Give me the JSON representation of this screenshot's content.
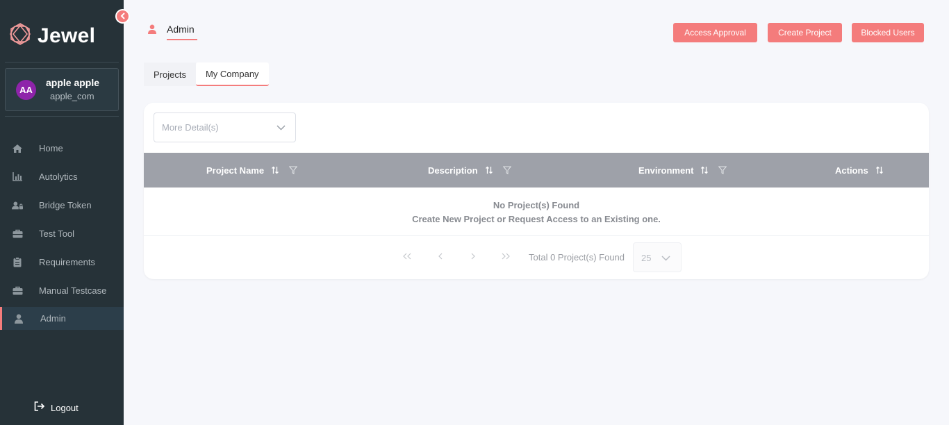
{
  "app": {
    "name": "Jewel"
  },
  "user": {
    "initials": "AA",
    "name": "apple apple",
    "handle": "apple_com"
  },
  "sidebar": {
    "items": [
      {
        "label": "Home",
        "icon": "home-icon"
      },
      {
        "label": "Autolytics",
        "icon": "bar-chart-icon"
      },
      {
        "label": "Bridge Token",
        "icon": "user-lock-icon"
      },
      {
        "label": "Test Tool",
        "icon": "toolbox-icon"
      },
      {
        "label": "Requirements",
        "icon": "clipboard-icon"
      },
      {
        "label": "Manual Testcase",
        "icon": "toolbox-icon"
      },
      {
        "label": "Admin",
        "icon": "user-icon",
        "active": true
      }
    ],
    "logout": "Logout"
  },
  "header": {
    "title": "Admin",
    "buttons": [
      "Access Approval",
      "Create Project",
      "Blocked Users"
    ]
  },
  "tabs": [
    {
      "label": "Projects",
      "active": false
    },
    {
      "label": "My Company",
      "active": true
    }
  ],
  "filter": {
    "placeholder": "More Detail(s)"
  },
  "table": {
    "columns": [
      "Project Name",
      "Description",
      "Environment",
      "Actions"
    ],
    "empty_title": "No Project(s) Found",
    "empty_subtitle": "Create New Project or Request Access to an Existing one."
  },
  "pagination": {
    "total_text": "Total 0 Project(s) Found",
    "page_size": "25"
  },
  "colors": {
    "accent": "#f47c7c",
    "sidebar_bg": "#263238",
    "table_header": "#9ea1a9",
    "avatar": "#8e24aa"
  }
}
